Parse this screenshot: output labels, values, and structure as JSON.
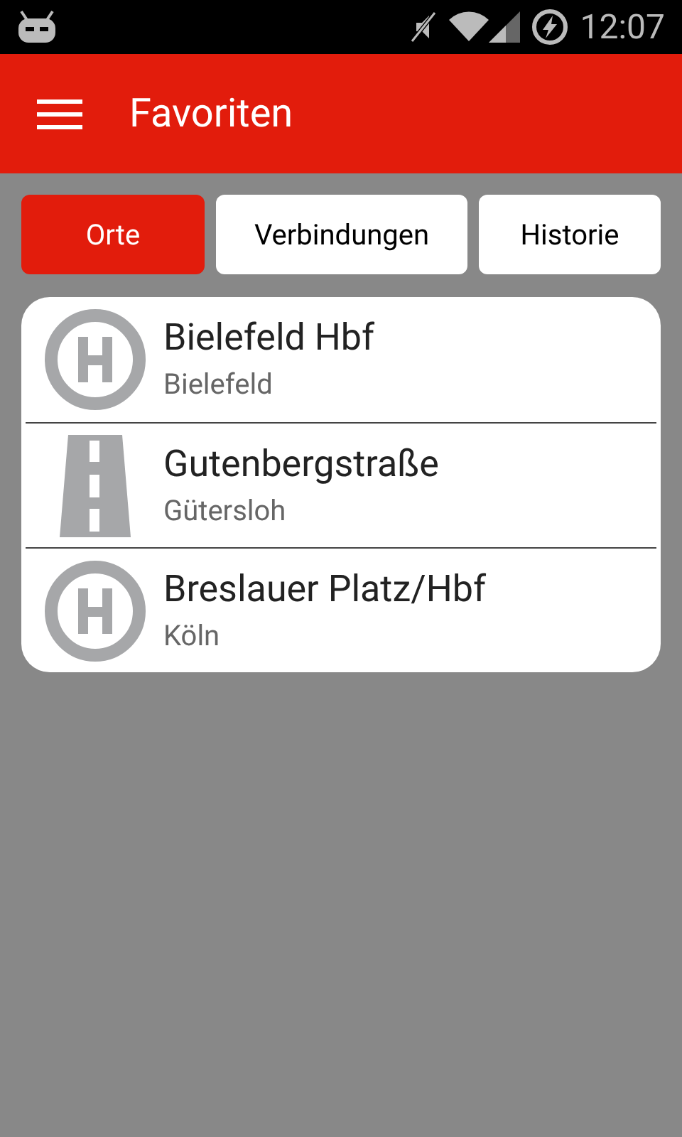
{
  "status_bar": {
    "time": "12:07"
  },
  "app_bar": {
    "title": "Favoriten"
  },
  "tabs": [
    {
      "label": "Orte",
      "selected": true
    },
    {
      "label": "Verbindungen",
      "selected": false
    },
    {
      "label": "Historie",
      "selected": false
    }
  ],
  "favorites": [
    {
      "kind": "stop",
      "name": "Bielefeld Hbf",
      "city": "Bielefeld"
    },
    {
      "kind": "street",
      "name": "Gutenbergstraße",
      "city": "Gütersloh"
    },
    {
      "kind": "stop",
      "name": "Breslauer Platz/Hbf",
      "city": "Köln"
    }
  ]
}
